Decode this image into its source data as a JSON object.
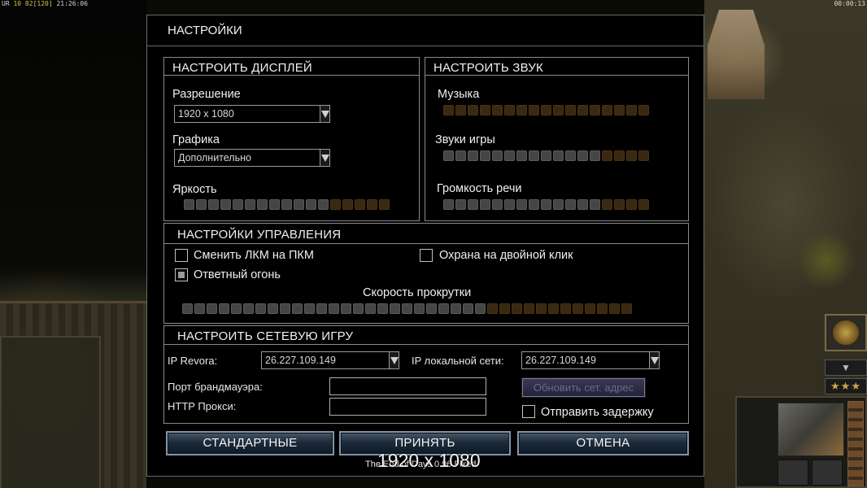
{
  "hud": {
    "top_left_prefix": "UR",
    "top_left_stats": "10 82",
    "top_left_bracket": "[120]",
    "top_left_time": "21:26:06",
    "top_right_time": "00:00:13",
    "stars": "★★★"
  },
  "dialog": {
    "title": "НАСТРОЙКИ"
  },
  "display": {
    "header": "НАСТРОИТЬ ДИСПЛЕЙ",
    "resolution_label": "Разрешение",
    "resolution_value": "1920 x 1080",
    "graphics_label": "Графика",
    "graphics_value": "Дополнительно",
    "brightness_label": "Яркость",
    "brightness": {
      "level": 12,
      "total": 17
    }
  },
  "sound": {
    "header": "НАСТРОИТЬ ЗВУК",
    "music_label": "Музыка",
    "music": {
      "level": 0,
      "total": 17
    },
    "sfx_label": "Звуки игры",
    "sfx": {
      "level": 13,
      "total": 17
    },
    "voice_label": "Громкость речи",
    "voice": {
      "level": 13,
      "total": 17
    }
  },
  "controls": {
    "header": "НАСТРОЙКИ УПРАВЛЕНИЯ",
    "swap_mouse_label": "Сменить ЛКМ на ПКМ",
    "swap_mouse_checked": false,
    "double_click_guard_label": "Охрана на двойной клик",
    "double_click_guard_checked": false,
    "retaliation_label": "Ответный огонь",
    "retaliation_checked": true,
    "scroll_speed_label": "Скорость прокрутки",
    "scroll_speed": {
      "level": 25,
      "total": 37
    }
  },
  "network": {
    "header": "НАСТРОИТЬ СЕТЕВУЮ ИГРУ",
    "ip_revora_label": "IP Revora:",
    "ip_revora_value": "26.227.109.149",
    "ip_lan_label": "IP локальной сети:",
    "ip_lan_value": "26.227.109.149",
    "firewall_port_label": "Порт брандмауэра:",
    "firewall_port_value": "",
    "http_proxy_label": "HTTP Прокси:",
    "http_proxy_value": "",
    "refresh_button": "Обновить сет. адрес",
    "send_delay_label": "Отправить задержку",
    "send_delay_checked": false
  },
  "buttons": {
    "defaults": "СТАНДАРТНЫЕ",
    "accept": "ПРИНЯТЬ",
    "cancel": "ОТМЕНА"
  },
  "tooltip": {
    "small_text": "The End of Days 0.96 Fixed",
    "big_text": "1920 x 1080"
  },
  "colors": {
    "slider_on": "#454545",
    "slider_off": "#3a2810",
    "button_border": "#8294a8",
    "panel_border": "#8a8a8a"
  }
}
